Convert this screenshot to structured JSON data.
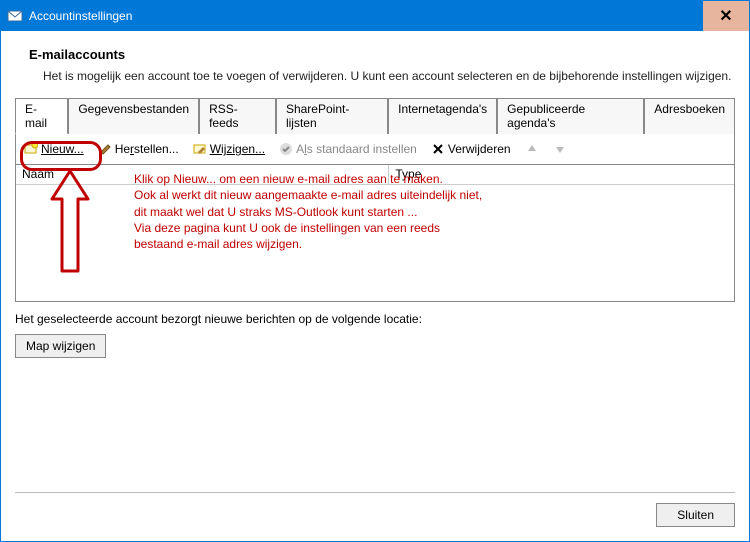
{
  "window": {
    "title": "Accountinstellingen"
  },
  "header": {
    "section": "E-mailaccounts",
    "description": "Het is mogelijk een account toe te voegen of verwijderen. U kunt een account selecteren en de bijbehorende instellingen wijzigen."
  },
  "tabs": [
    {
      "label": "E-mail",
      "active": true
    },
    {
      "label": "Gegevensbestanden",
      "active": false
    },
    {
      "label": "RSS-feeds",
      "active": false
    },
    {
      "label": "SharePoint-lijsten",
      "active": false
    },
    {
      "label": "Internetagenda's",
      "active": false
    },
    {
      "label": "Gepubliceerde agenda's",
      "active": false
    },
    {
      "label": "Adresboeken",
      "active": false
    }
  ],
  "toolbar": {
    "new": "Nieuw...",
    "repair": "Herstellen...",
    "change": "Wijzigen...",
    "setdefault": "Als standaard instellen",
    "remove": "Verwijderen"
  },
  "columns": {
    "name": "Naam",
    "type": "Type"
  },
  "rows": [],
  "annotation": {
    "line1": "Klik op Nieuw...  om een nieuw e-mail adres aan te maken.",
    "line2": "Ook al werkt dit nieuw aangemaakte e-mail adres uiteindelijk niet,",
    "line3": "dit maakt wel dat U straks MS-Outlook kunt starten ...",
    "line4": "Via deze pagina kunt U ook de instellingen van een reeds",
    "line5": " bestaand e-mail adres wijzigen."
  },
  "location": {
    "label": "Het geselecteerde account bezorgt nieuwe berichten op de volgende locatie:",
    "changeFolder": "Map wijzigen"
  },
  "buttons": {
    "close": "Sluiten"
  }
}
